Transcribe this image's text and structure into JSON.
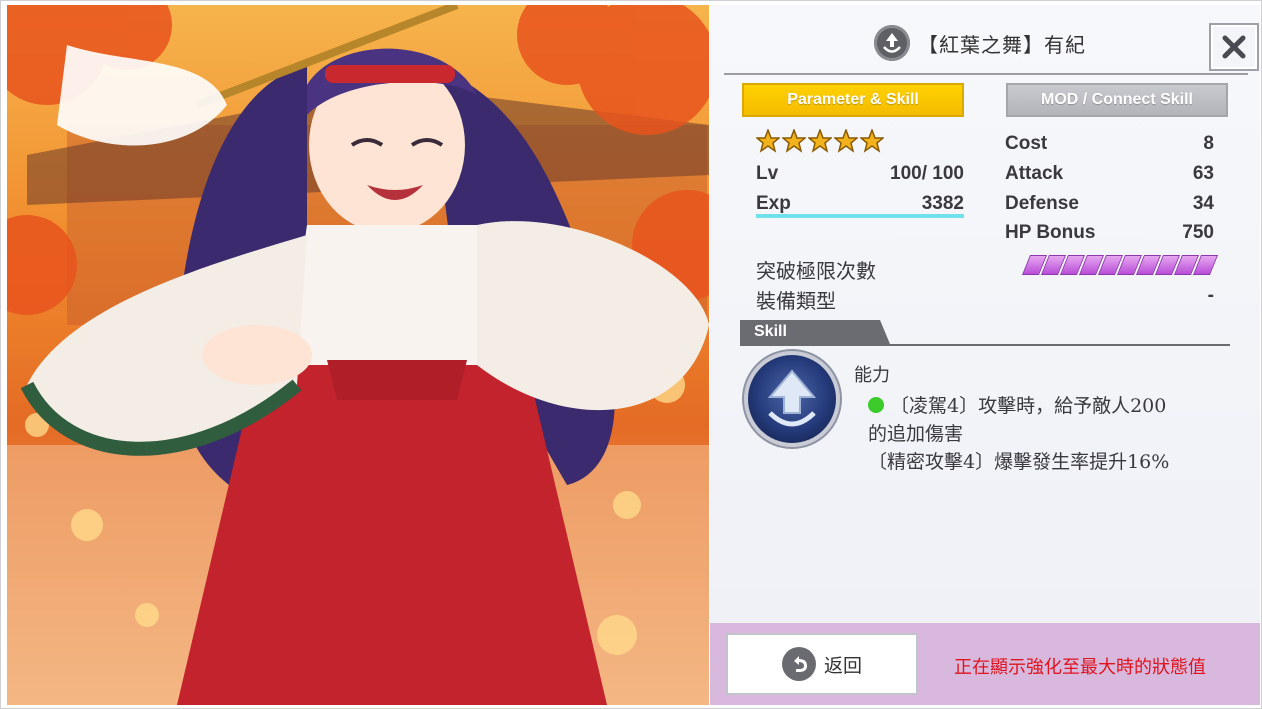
{
  "card": {
    "title": "【紅葉之舞】有紀",
    "close_icon": "close-icon",
    "rarity_stars": 5
  },
  "tabs": [
    {
      "label": "Parameter & Skill",
      "active": true
    },
    {
      "label": "MOD / Connect Skill",
      "active": false
    }
  ],
  "params": {
    "lv_label": "Lv",
    "lv_value": "100/ 100",
    "exp_label": "Exp",
    "exp_value": "3382",
    "cost_label": "Cost",
    "cost_value": "8",
    "attack_label": "Attack",
    "attack_value": "63",
    "defense_label": "Defense",
    "defense_value": "34",
    "hp_label": "HP Bonus",
    "hp_value": "750",
    "limit_break_label": "突破極限次數",
    "limit_break_segments": 10,
    "equip_type_label": "裝備類型",
    "equip_type_value": "-"
  },
  "skill": {
    "header": "Skill",
    "name": "能力",
    "icon": "upward-arrow-icon",
    "line1": "〔凌駕4〕攻擊時，給予敵人200",
    "line2": "的追加傷害",
    "line3": "〔精密攻擊4〕爆擊發生率提升16%"
  },
  "footer": {
    "back_label": "返回",
    "notice": "正在顯示強化至最大時的狀態值"
  },
  "colors": {
    "tab_active": "#f4bc00",
    "tab_inactive": "#b3b4b9",
    "exp_bar": "#6fe1ea",
    "limit_segment": "#b84ed8",
    "notice_text": "#e0141e",
    "footer_bg": "#d9b8de",
    "star": "#f2b21c"
  }
}
